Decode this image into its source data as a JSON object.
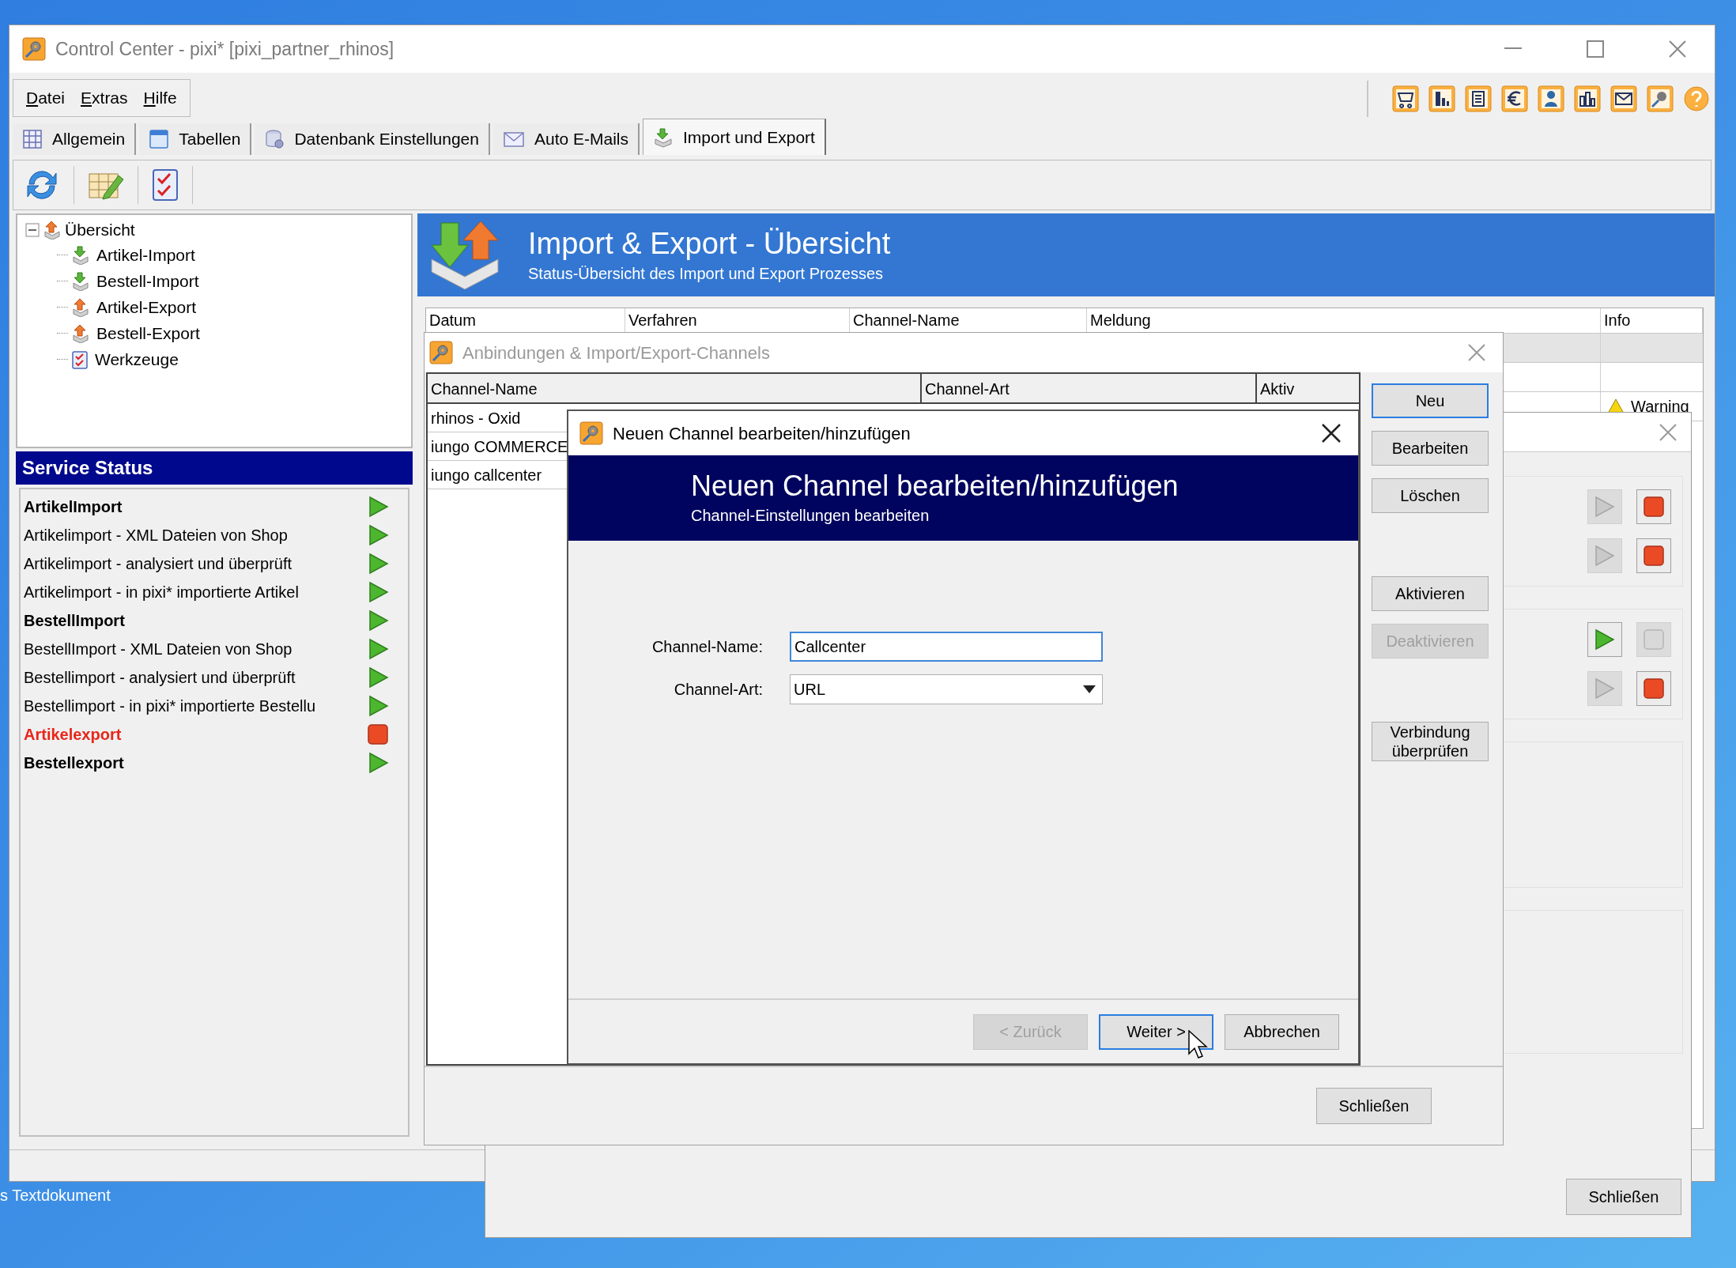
{
  "desktop": {
    "file_label": "s Textdokument"
  },
  "main_window": {
    "title": "Control Center - pixi* [pixi_partner_rhinos]",
    "menu": [
      "Datei",
      "Extras",
      "Hilfe"
    ],
    "tabs": [
      {
        "label": "Allgemein",
        "selected": false
      },
      {
        "label": "Tabellen",
        "selected": false
      },
      {
        "label": "Datenbank Einstellungen",
        "selected": false
      },
      {
        "label": "Auto E-Mails",
        "selected": false
      },
      {
        "label": "Import und Export",
        "selected": true
      }
    ],
    "tree": {
      "label": "Übersicht",
      "expanded": true,
      "children": [
        {
          "label": "Artikel-Import",
          "kind": "import"
        },
        {
          "label": "Bestell-Import",
          "kind": "import"
        },
        {
          "label": "Artikel-Export",
          "kind": "export"
        },
        {
          "label": "Bestell-Export",
          "kind": "export"
        },
        {
          "label": "Werkzeuge",
          "kind": "tools"
        }
      ]
    },
    "service_status": {
      "title": "Service Status",
      "items": [
        {
          "label": "ArtikelImport",
          "bold": true,
          "running": true
        },
        {
          "label": "Artikelimport - XML Dateien von Shop",
          "bold": false,
          "running": true
        },
        {
          "label": "Artikelimport - analysiert und überprüft",
          "bold": false,
          "running": true
        },
        {
          "label": "Artikelimport - in pixi* importierte Artikel",
          "bold": false,
          "running": true
        },
        {
          "label": "BestellImport",
          "bold": true,
          "running": true
        },
        {
          "label": "BestellImport - XML Dateien von Shop",
          "bold": false,
          "running": true
        },
        {
          "label": "Bestellimport - analysiert und überprüft",
          "bold": false,
          "running": true
        },
        {
          "label": "Bestellimport - in pixi* importierte Bestellu",
          "bold": false,
          "running": true
        },
        {
          "label": "Artikelexport",
          "bold": true,
          "running": false
        },
        {
          "label": "Bestellexport",
          "bold": true,
          "running": true
        }
      ]
    },
    "header": {
      "title": "Import & Export - Übersicht",
      "subtitle": "Status-Übersicht des Import und Export Prozesses"
    },
    "log_table": {
      "columns": [
        "Datum",
        "Verfahren",
        "Channel-Name",
        "Meldung",
        "Info"
      ],
      "rows": [
        {
          "kind": "empty",
          "selected": true
        },
        {
          "kind": "empty",
          "selected": false
        },
        {
          "kind": "warning",
          "info": "Warning",
          "selected": false
        }
      ]
    }
  },
  "service_window": {
    "panels": [
      {
        "rows": [
          {
            "play_enabled": false,
            "stop_enabled": true
          },
          {
            "play_enabled": false,
            "stop_enabled": true
          }
        ]
      },
      {
        "rows": [
          {
            "play_enabled": true,
            "stop_enabled": false
          },
          {
            "play_enabled": false,
            "stop_enabled": true
          }
        ]
      }
    ],
    "close_button": "Schließen"
  },
  "channels_dialog": {
    "title": "Anbindungen & Import/Export-Channels",
    "columns": [
      "Channel-Name",
      "Channel-Art",
      "Aktiv"
    ],
    "rows": [
      {
        "name": "rhinos - Oxid"
      },
      {
        "name": "iungo COMMERCE"
      },
      {
        "name": "iungo callcenter"
      }
    ],
    "button_groups": [
      [
        {
          "label": "Neu",
          "disabled": false,
          "default": true
        },
        {
          "label": "Bearbeiten",
          "disabled": false,
          "default": false
        },
        {
          "label": "Löschen",
          "disabled": false,
          "default": false
        }
      ],
      [
        {
          "label": "Aktivieren",
          "disabled": false,
          "default": false
        },
        {
          "label": "Deaktivieren",
          "disabled": true,
          "default": false
        }
      ],
      [
        {
          "label": "Verbindung überprüfen",
          "disabled": false,
          "default": false
        }
      ]
    ],
    "close_button": "Schließen"
  },
  "channel_dialog": {
    "title": "Neuen Channel bearbeiten/hinzufügen",
    "header_title": "Neuen Channel bearbeiten/hinzufügen",
    "header_subtitle": "Channel-Einstellungen bearbeiten",
    "fields": [
      {
        "kind": "text",
        "label": "Channel-Name:",
        "value": "Callcenter"
      },
      {
        "kind": "select",
        "label": "Channel-Art:",
        "value": "URL"
      }
    ],
    "buttons": [
      {
        "label": "< Zurück",
        "disabled": true,
        "default": false
      },
      {
        "label": "Weiter >",
        "disabled": false,
        "default": true
      },
      {
        "label": "Abbrechen",
        "disabled": false,
        "default": false
      }
    ]
  }
}
